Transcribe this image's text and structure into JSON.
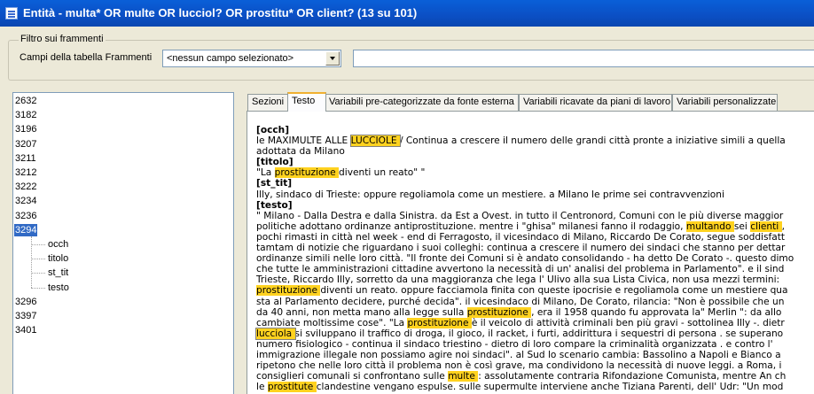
{
  "window": {
    "title": "Entità - multa* OR multe OR lucciol? OR prostitu* OR client? (13 su 101)"
  },
  "filter": {
    "group_label": "Filtro sui frammenti",
    "field_label": "Campi della tabella Frammenti",
    "combo_value": "<nessun campo selezionato>",
    "text_value": ""
  },
  "tree": {
    "items": [
      "2632",
      "3182",
      "3196",
      "3207",
      "3211",
      "3212",
      "3222",
      "3234",
      "3236",
      "3294",
      "3296",
      "3397",
      "3401"
    ],
    "selected": "3294",
    "children": [
      "occh",
      "titolo",
      "st_tit",
      "testo"
    ]
  },
  "tabs": [
    {
      "label": "Sezioni"
    },
    {
      "label": "Testo"
    },
    {
      "label": "Variabili pre-categorizzate da fonte esterna"
    },
    {
      "label": "Variabili ricavate da piani di lavoro"
    },
    {
      "label": "Variabili personalizzate"
    }
  ],
  "active_tab": "Testo",
  "document": {
    "lines": [
      [
        {
          "t": "[occh]",
          "k": "tag"
        }
      ],
      [
        {
          "t": "le MAXIMULTE ALLE "
        },
        {
          "t": "LUCCIOLE ",
          "k": "hl-sel"
        },
        {
          "t": "/ Continua a crescere il numero delle grandi città pronte a iniziative simili a quella"
        }
      ],
      [
        {
          "t": "adottata da Milano"
        }
      ],
      [
        {
          "t": "[titolo]",
          "k": "tag"
        }
      ],
      [
        {
          "t": "\"La "
        },
        {
          "t": "prostituzione ",
          "k": "hl"
        },
        {
          "t": "diventi un reato\" \""
        }
      ],
      [
        {
          "t": "[st_tit]",
          "k": "tag"
        }
      ],
      [
        {
          "t": "Illy, sindaco di Trieste: oppure regoliamola come un mestiere. a Milano le prime sei contravvenzioni"
        }
      ],
      [
        {
          "t": "[testo]",
          "k": "tag"
        }
      ],
      [
        {
          "t": "\" Milano - Dalla Destra e dalla Sinistra. da Est a Ovest. in tutto il Centronord, Comuni con le più diverse maggior"
        }
      ],
      [
        {
          "t": "politiche adottano ordinanze antiprostituzione. mentre i \"ghisa\" milanesi fanno il rodaggio, "
        },
        {
          "t": "multando ",
          "k": "hl"
        },
        {
          "t": "sei "
        },
        {
          "t": "clienti ",
          "k": "hl"
        },
        {
          "t": ","
        }
      ],
      [
        {
          "t": "pochi rimasti in città nel week - end di Ferragosto, il vicesindaco di Milano, Riccardo De Corato, segue soddisfatt"
        }
      ],
      [
        {
          "t": "tamtam di notizie che riguardano i suoi colleghi: continua a crescere il numero dei sindaci che stanno per dettar"
        }
      ],
      [
        {
          "t": "ordinanze simili nelle loro città. \"Il fronte dei Comuni si è andato consolidando - ha detto De Corato -. questo dimo"
        }
      ],
      [
        {
          "t": "che tutte le amministrazioni cittadine avvertono la necessità di un' analisi del problema in Parlamento\". e il sind"
        }
      ],
      [
        {
          "t": "Trieste, Riccardo Illy, sorretto da una maggioranza che lega l' Ulivo alla sua Lista Civica, non usa mezzi termini:"
        }
      ],
      [
        {
          "t": "prostituzione ",
          "k": "hl"
        },
        {
          "t": "diventi un reato. oppure facciamola finita con queste ipocrisie e regoliamola come un mestiere qua"
        }
      ],
      [
        {
          "t": "sta al Parlamento decidere, purché decida\". il vicesindaco di Milano, De Corato, rilancia: \"Non è possibile che un"
        }
      ],
      [
        {
          "t": "da 40 anni, non metta mano alla legge sulla "
        },
        {
          "t": "prostituzione ",
          "k": "hl"
        },
        {
          "t": ", era il 1958 quando fu approvata la\" Merlin \": da allo"
        }
      ],
      [
        {
          "t": "cambiate moltissime cose\". \"La "
        },
        {
          "t": "prostituzione ",
          "k": "hl"
        },
        {
          "t": "è il veicolo di attività criminali ben più gravi - sottolinea Illy -. dietr"
        }
      ],
      [
        {
          "t": "lucciola ",
          "k": "hl-sel"
        },
        {
          "t": "si sviluppano il traffico di droga, il gioco, il racket, i furti, addirittura i sequestri di persona . se superano"
        }
      ],
      [
        {
          "t": "numero fisiologico - continua il sindaco triestino - dietro di loro compare la criminalità organizzata . e contro l'"
        }
      ],
      [
        {
          "t": "immigrazione illegale non possiamo agire noi sindaci\". al Sud lo scenario cambia: Bassolino a Napoli e Bianco a"
        }
      ],
      [
        {
          "t": "ripetono che nelle loro città il problema non è così grave, ma condividono la necessità di nuove leggi. a Roma, i"
        }
      ],
      [
        {
          "t": "consiglieri comunali si confrontano sulle "
        },
        {
          "t": "multe ",
          "k": "hl"
        },
        {
          "t": ": assolutamente contraria Rifondazione Comunista, mentre An ch"
        }
      ],
      [
        {
          "t": "le "
        },
        {
          "t": "prostitute ",
          "k": "hl"
        },
        {
          "t": "clandestine vengano espulse. sulle supermulte interviene anche Tiziana Parenti, dell' Udr: \"Un mod"
        }
      ]
    ]
  }
}
